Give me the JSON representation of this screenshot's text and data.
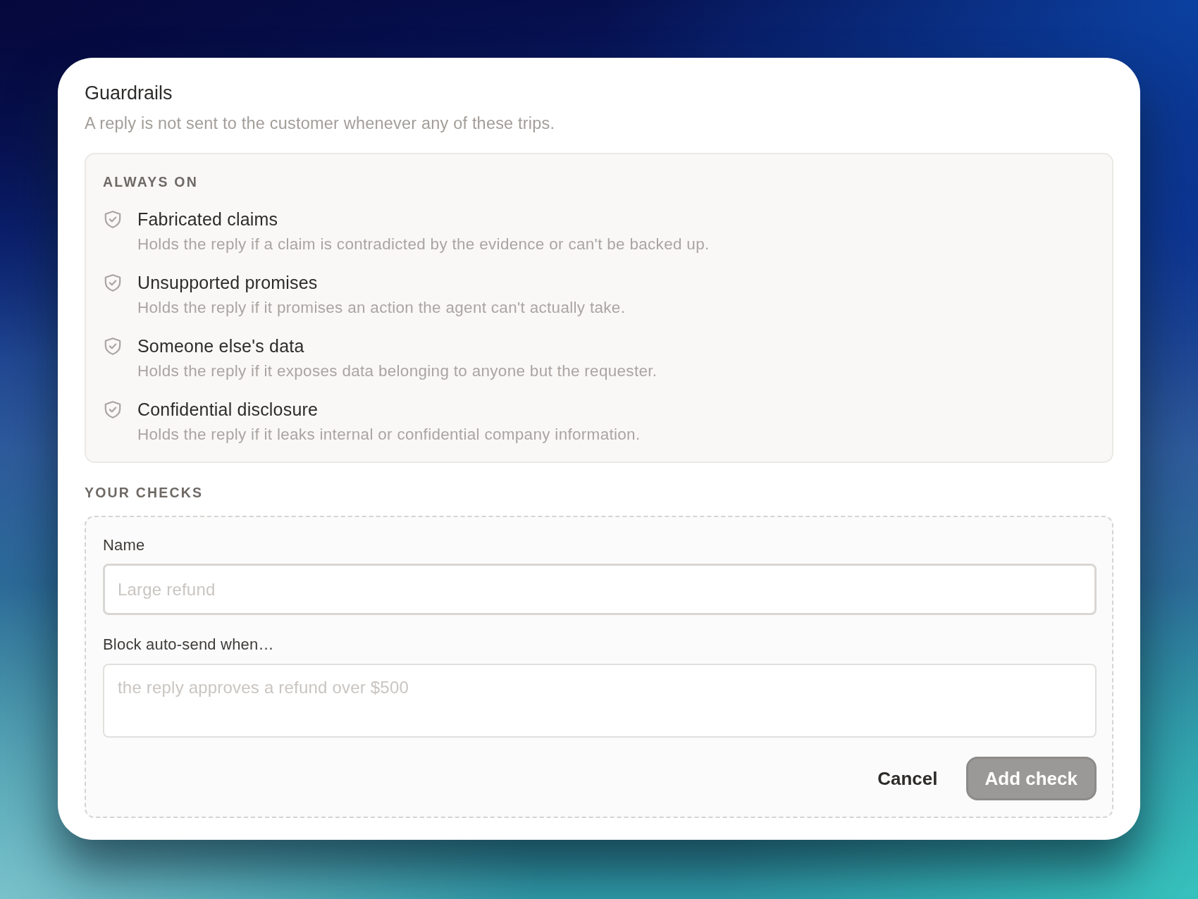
{
  "dialog": {
    "title": "Guardrails",
    "subtitle": "A reply is not sent to the customer whenever any of these trips."
  },
  "always_on": {
    "heading": "ALWAYS ON",
    "items": [
      {
        "title": "Fabricated claims",
        "description": "Holds the reply if a claim is contradicted by the evidence or can't be backed up."
      },
      {
        "title": "Unsupported promises",
        "description": "Holds the reply if it promises an action the agent can't actually take."
      },
      {
        "title": "Someone else's data",
        "description": "Holds the reply if it exposes data belonging to anyone but the requester."
      },
      {
        "title": "Confidential disclosure",
        "description": "Holds the reply if it leaks internal or confidential company information."
      }
    ]
  },
  "your_checks": {
    "heading": "YOUR CHECKS",
    "fields": [
      {
        "kind": "input",
        "label": "Name",
        "placeholder": "Large refund"
      },
      {
        "kind": "textarea",
        "label": "Block auto-send when…",
        "placeholder": "the reply approves a refund over $500"
      }
    ],
    "buttons": [
      {
        "kind": "link",
        "label": "Cancel",
        "disabled": false
      },
      {
        "kind": "primary",
        "label": "Add check",
        "disabled": true
      }
    ]
  }
}
